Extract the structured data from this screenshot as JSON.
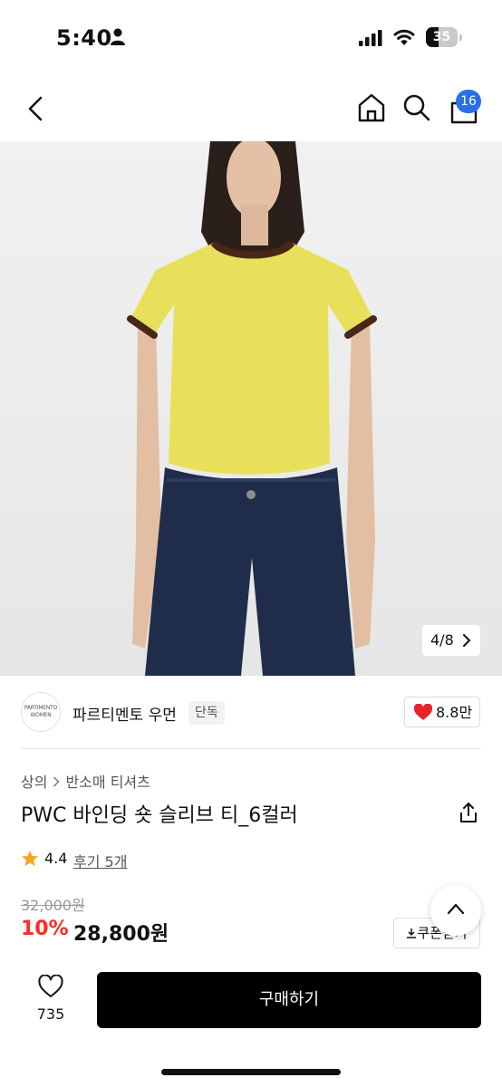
{
  "status_bar": {
    "time": "5:40",
    "battery_level": "35"
  },
  "nav": {
    "cart_count": "16"
  },
  "gallery": {
    "counter": "4/8"
  },
  "brand": {
    "logo_text": "PARTIMENTO WOMEN",
    "name": "파르티멘토 우먼",
    "tag": "단독",
    "like_count": "8.8만"
  },
  "product": {
    "breadcrumb": [
      "상의",
      "반소매 티셔츠"
    ],
    "title": "PWC 바인딩 숏 슬리브 티_6컬러",
    "rating": "4.4",
    "review_link": "후기 5개",
    "original_price": "32,000원",
    "discount": "10%",
    "sale_price": "28,800원",
    "coupon_label": "쿠폰받기"
  },
  "bottom_bar": {
    "wish_count": "735",
    "buy_label": "구매하기"
  },
  "colors": {
    "accent_blue": "#2a6ee8",
    "discount_red": "#ff2a23",
    "heart_red": "#e8242b",
    "star_orange": "#f5a623",
    "tshirt_yellow": "#e8e05a",
    "trim_brown": "#4a2617",
    "jeans_navy": "#1f2d4a"
  }
}
